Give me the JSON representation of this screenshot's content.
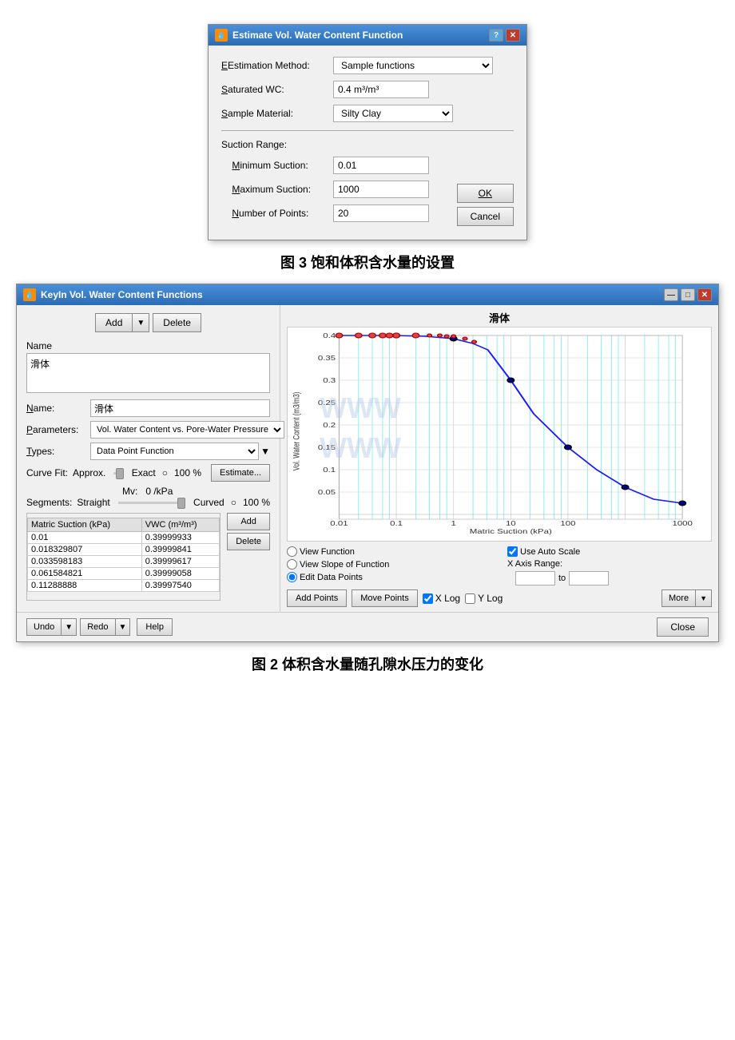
{
  "dialog1": {
    "title": "Estimate Vol. Water Content Function",
    "icon": "💧",
    "fields": {
      "estimation_method_label": "Estimation Method:",
      "estimation_method_value": "Sample functions",
      "saturated_wc_label": "Saturated WC:",
      "saturated_wc_value": "0.4 m³/m³",
      "sample_material_label": "Sample Material:",
      "sample_material_value": "Silty Clay",
      "suction_range_label": "Suction Range:",
      "minimum_suction_label": "Minimum Suction:",
      "minimum_suction_value": "0.01",
      "maximum_suction_label": "Maximum Suction:",
      "maximum_suction_value": "1000",
      "number_of_points_label": "Number of Points:",
      "number_of_points_value": "20"
    },
    "buttons": {
      "ok": "OK",
      "cancel": "Cancel"
    }
  },
  "caption1": "图 3 饱和体积含水量的设置",
  "dialog2": {
    "title": "KeyIn Vol. Water Content Functions",
    "icon": "💧",
    "toolbar": {
      "add_label": "Add",
      "delete_label": "Delete"
    },
    "left_panel": {
      "name_section_label": "Name",
      "name_value": "滑体",
      "name_field_label": "Name:",
      "name_field_value": "滑体",
      "parameters_label": "Parameters:",
      "parameters_value": "Vol. Water Content vs. Pore-Water Pressure",
      "types_label": "Types:",
      "types_value": "Data Point Function",
      "curve_fit_label": "Curve Fit:",
      "approx_label": "Approx.",
      "exact_label": "Exact",
      "curve_pct": "100 %",
      "estimate_btn": "Estimate...",
      "mv_label": "Mv:",
      "mv_value": "0 /kPa",
      "segments_label": "Segments:",
      "straight_label": "Straight",
      "curved_label": "Curved",
      "seg_pct": "100 %",
      "table": {
        "col1": "Matric Suction (kPa)",
        "col2": "VWC (m³/m³)",
        "rows": [
          {
            "col1": "0.01",
            "col2": "0.39999933"
          },
          {
            "col1": "0.018329807",
            "col2": "0.39999841"
          },
          {
            "col1": "0.033598183",
            "col2": "0.39999617"
          },
          {
            "col1": "0.061584821",
            "col2": "0.39999058"
          },
          {
            "col1": "0.11288888",
            "col2": "0.39997540"
          }
        ],
        "add_btn": "Add",
        "delete_btn": "Delete"
      }
    },
    "right_panel": {
      "chart_title": "滑体",
      "y_axis_label": "Vol. Water Content (m3/m3)",
      "x_axis_label": "Matric Suction (kPa)",
      "y_values": [
        0.4,
        0.35,
        0.3,
        0.25,
        0.2,
        0.15,
        0.1,
        0.05
      ],
      "x_labels": [
        "0.01",
        "0.1",
        "1",
        "10",
        "100",
        "1000"
      ],
      "options": {
        "view_function": "View Function",
        "view_slope": "View Slope of Function",
        "edit_data": "Edit Data Points",
        "use_auto_scale": "Use Auto Scale",
        "x_axis_range": "X Axis Range:",
        "to_label": "to",
        "add_points": "Add Points",
        "move_points": "Move Points",
        "x_log": "X Log",
        "y_log": "Y Log",
        "more": "More"
      }
    },
    "footer": {
      "undo": "Undo",
      "redo": "Redo",
      "help": "Help",
      "close": "Close"
    }
  },
  "caption2": "图 2 体积含水量随孔隙水压力的变化"
}
